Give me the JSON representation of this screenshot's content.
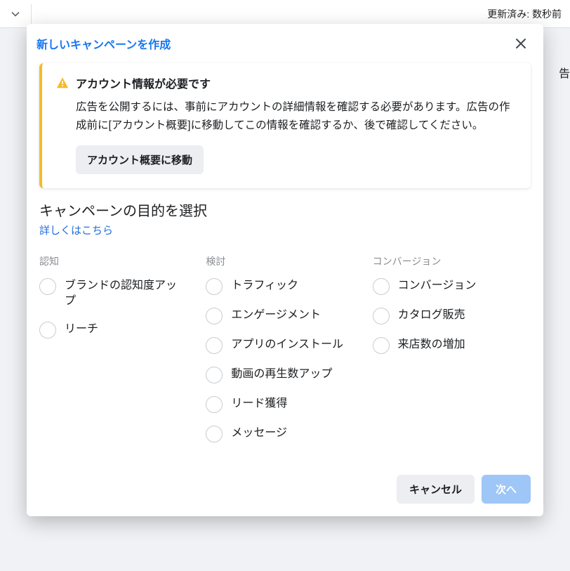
{
  "topbar": {
    "status": "更新済み: 数秒前"
  },
  "peek_label": "告",
  "modal": {
    "title": "新しいキャンペーンを作成",
    "alert": {
      "title": "アカウント情報が必要です",
      "body": "広告を公開するには、事前にアカウントの詳細情報を確認する必要があります。広告の作成前に[アカウント概要]に移動してこの情報を確認するか、後で確認してください。",
      "button": "アカウント概要に移動"
    },
    "section_title": "キャンペーンの目的を選択",
    "learn_more": "詳しくはこちら",
    "columns": [
      {
        "head": "認知",
        "options": [
          "ブランドの認知度アップ",
          "リーチ"
        ]
      },
      {
        "head": "検討",
        "options": [
          "トラフィック",
          "エンゲージメント",
          "アプリのインストール",
          "動画の再生数アップ",
          "リード獲得",
          "メッセージ"
        ]
      },
      {
        "head": "コンバージョン",
        "options": [
          "コンバージョン",
          "カタログ販売",
          "来店数の増加"
        ]
      }
    ],
    "footer": {
      "cancel": "キャンセル",
      "next": "次へ"
    }
  }
}
